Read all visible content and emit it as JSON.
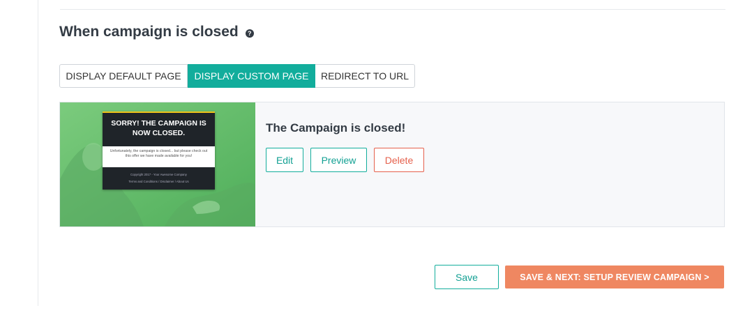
{
  "section": {
    "title": "When campaign is closed",
    "help_icon": "?"
  },
  "modes": {
    "items": [
      {
        "label": "DISPLAY DEFAULT PAGE"
      },
      {
        "label": "DISPLAY CUSTOM PAGE"
      },
      {
        "label": "REDIRECT TO URL"
      }
    ],
    "selected": "DISPLAY CUSTOM PAGE",
    "accent_color": "#12ad9c"
  },
  "custom_page": {
    "title": "The Campaign is closed!",
    "preview": {
      "headline": "SORRY! THE CAMPAIGN IS NOW CLOSED.",
      "body": "Unfortunately, the campaign is closed... but please check out this offer we have made available for you!",
      "copyright": "Copyright 2017 - Your Awesome Company",
      "links": "Terms and Conditions   /   Disclaimer   /   About Us"
    },
    "actions": {
      "edit": "Edit",
      "preview": "Preview",
      "delete": "Delete"
    }
  },
  "footer": {
    "save": "Save",
    "save_next": "SAVE & NEXT: SETUP REVIEW CAMPAIGN >",
    "save_next_color": "#ef8761"
  }
}
